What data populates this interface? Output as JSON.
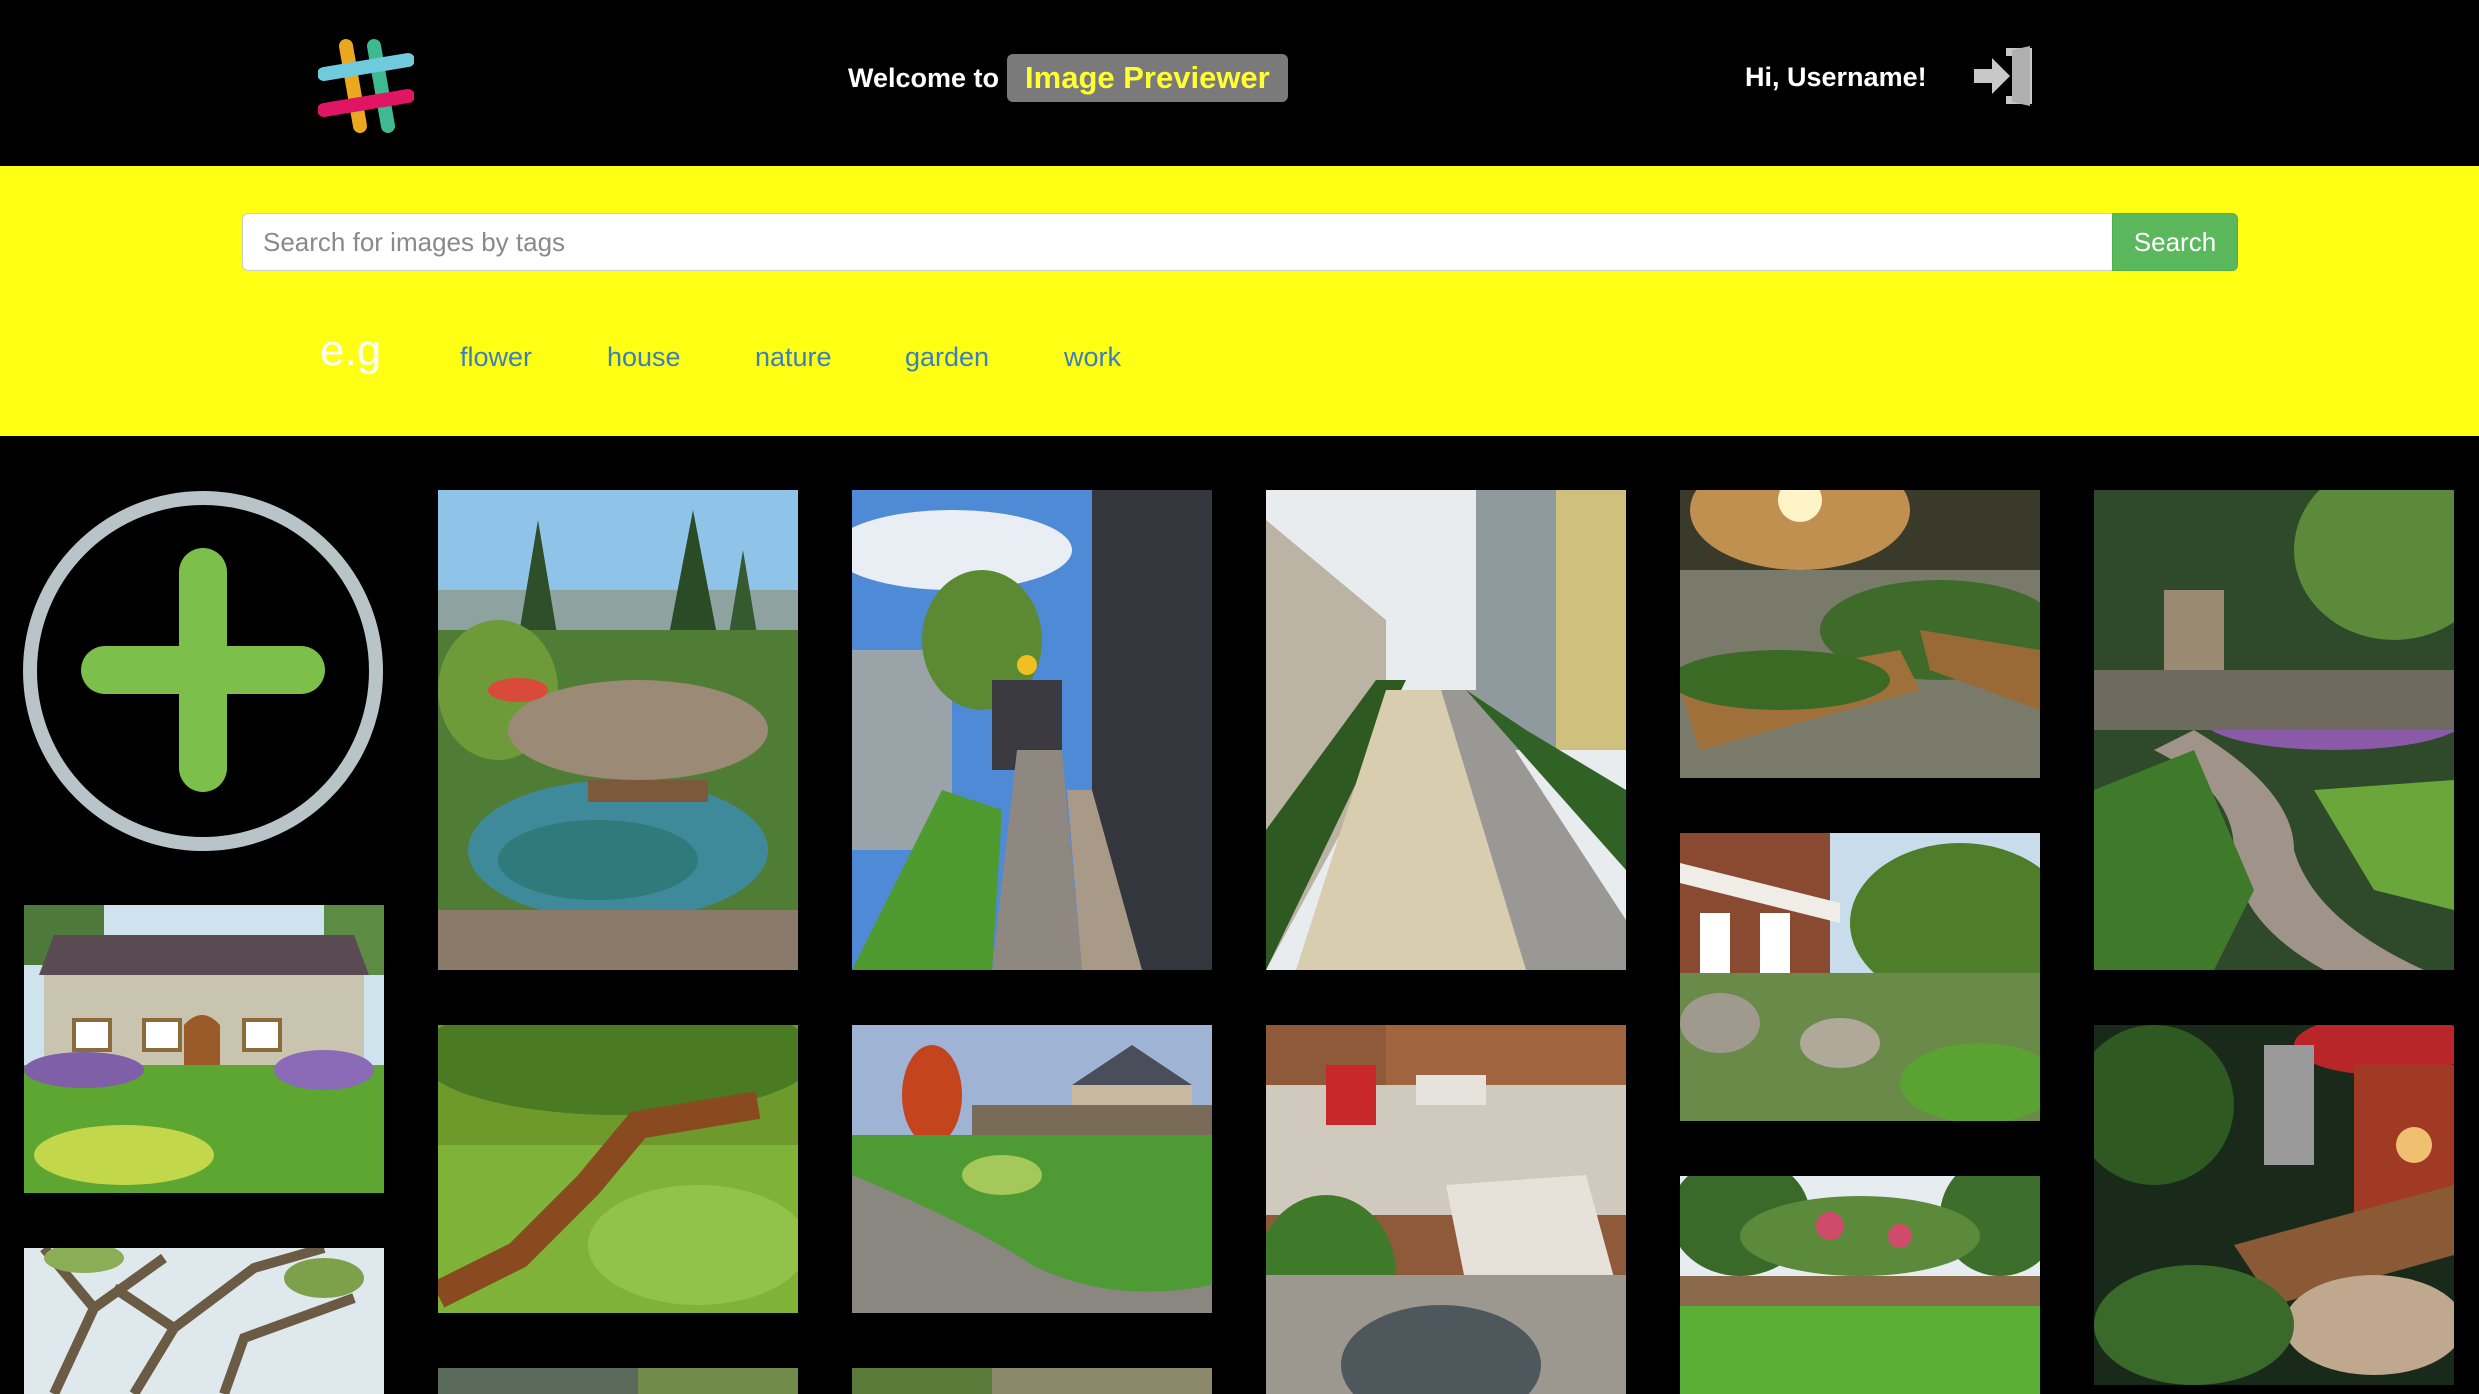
{
  "header": {
    "welcome_text": "Welcome to",
    "app_name": "Image Previewer",
    "greeting_prefix": "Hi, ",
    "username": "Username!",
    "logo_icon": "slack-hash-logo-icon",
    "logout_icon": "sign-in-door-icon"
  },
  "search": {
    "placeholder": "Search for images by tags",
    "value": "",
    "button_label": "Search"
  },
  "suggestions": {
    "prefix": "e.g",
    "tags": [
      "flower",
      "house",
      "nature",
      "garden",
      "work"
    ]
  },
  "gallery": {
    "add_icon": "plus-circle-icon",
    "images": [
      {
        "subject": "cottage-lawn"
      },
      {
        "subject": "tree-branches"
      },
      {
        "subject": "pond-rock-garden"
      },
      {
        "subject": "wooden-fence-lawn"
      },
      {
        "subject": "garden-partial"
      },
      {
        "subject": "paver-path-shed"
      },
      {
        "subject": "river-rock-bed"
      },
      {
        "subject": "garden-partial"
      },
      {
        "subject": "stepping-stone-side-yard"
      },
      {
        "subject": "patio-fire-pit"
      },
      {
        "subject": "raised-garden-beds"
      },
      {
        "subject": "porch-boulder-garden"
      },
      {
        "subject": "lawn-flowering-trees"
      },
      {
        "subject": "curved-stone-path-patio"
      },
      {
        "subject": "lit-modern-garden"
      }
    ]
  },
  "colors": {
    "header_bg": "#000000",
    "search_band_bg": "#ffff14",
    "badge_bg": "#7a7a7a",
    "badge_text": "#ffff33",
    "search_button": "#5cb85c",
    "tag_link": "#3a7fbf",
    "add_icon_ring": "#b8c4c8",
    "add_icon_plus": "#7cc04b"
  }
}
